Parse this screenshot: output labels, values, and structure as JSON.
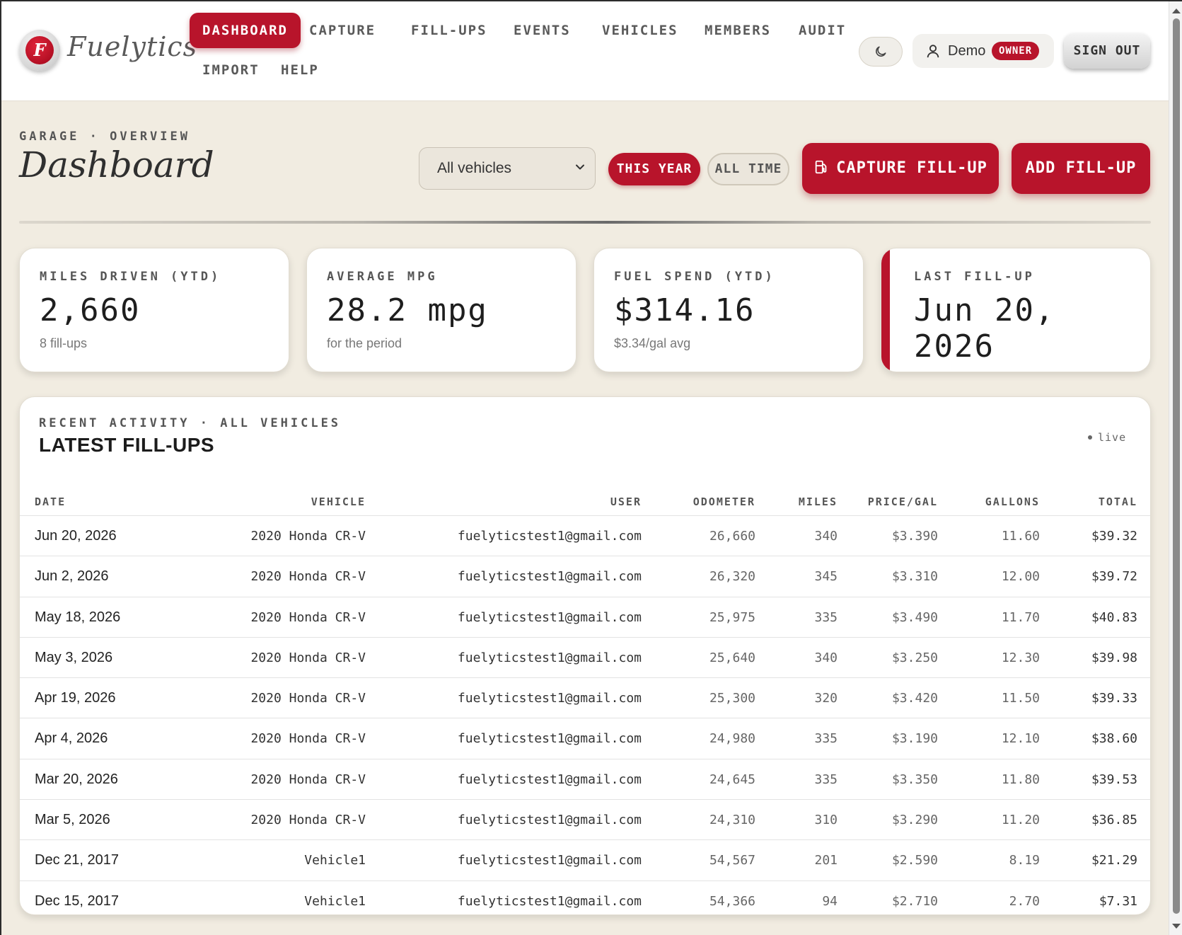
{
  "app": {
    "name": "Fuelytics",
    "logo_letter": "F"
  },
  "nav": {
    "items": [
      {
        "label": "DASHBOARD",
        "active": true
      },
      {
        "label": "CAPTURE",
        "active": false
      },
      {
        "label": "FILL-UPS",
        "active": false
      },
      {
        "label": "EVENTS",
        "active": false
      },
      {
        "label": "VEHICLES",
        "active": false
      },
      {
        "label": "MEMBERS",
        "active": false
      },
      {
        "label": "AUDIT",
        "active": false
      },
      {
        "label": "IMPORT",
        "active": false
      },
      {
        "label": "HELP",
        "active": false
      }
    ]
  },
  "header": {
    "theme_icon": "moon-icon",
    "user_name": "Demo",
    "role_badge": "OWNER",
    "signout_label": "SIGN OUT"
  },
  "page": {
    "eyebrow": "GARAGE · OVERVIEW",
    "title": "Dashboard",
    "vehicle_filter": {
      "selected": "All vehicles"
    },
    "range_buttons": {
      "this_year": "THIS YEAR",
      "all_time": "ALL TIME",
      "selected": "THIS YEAR"
    },
    "capture_label": "CAPTURE FILL-UP",
    "add_label": "ADD FILL-UP"
  },
  "stats": [
    {
      "label": "MILES DRIVEN (YTD)",
      "value": "2,660",
      "sub": "8 fill-ups"
    },
    {
      "label": "AVERAGE MPG",
      "value": "28.2 mpg",
      "sub": "for the period"
    },
    {
      "label": "FUEL SPEND (YTD)",
      "value": "$314.16",
      "sub": "$3.34/gal avg"
    },
    {
      "label": "LAST FILL-UP",
      "value": "Jun 20, 2026",
      "sub": ""
    }
  ],
  "fillups": {
    "eyebrow": "RECENT ACTIVITY · ALL VEHICLES",
    "title": "LATEST FILL-UPS",
    "live_label": "live",
    "columns": [
      "DATE",
      "VEHICLE",
      "USER",
      "ODOMETER",
      "MILES",
      "PRICE/GAL",
      "GALLONS",
      "TOTAL"
    ],
    "rows": [
      {
        "date": "Jun 20, 2026",
        "vehicle": "2020 Honda CR-V",
        "user": "fuelyticstest1@gmail.com",
        "odometer": "26,660",
        "miles": "340",
        "price": "$3.390",
        "gallons": "11.60",
        "total": "$39.32"
      },
      {
        "date": "Jun 2, 2026",
        "vehicle": "2020 Honda CR-V",
        "user": "fuelyticstest1@gmail.com",
        "odometer": "26,320",
        "miles": "345",
        "price": "$3.310",
        "gallons": "12.00",
        "total": "$39.72"
      },
      {
        "date": "May 18, 2026",
        "vehicle": "2020 Honda CR-V",
        "user": "fuelyticstest1@gmail.com",
        "odometer": "25,975",
        "miles": "335",
        "price": "$3.490",
        "gallons": "11.70",
        "total": "$40.83"
      },
      {
        "date": "May 3, 2026",
        "vehicle": "2020 Honda CR-V",
        "user": "fuelyticstest1@gmail.com",
        "odometer": "25,640",
        "miles": "340",
        "price": "$3.250",
        "gallons": "12.30",
        "total": "$39.98"
      },
      {
        "date": "Apr 19, 2026",
        "vehicle": "2020 Honda CR-V",
        "user": "fuelyticstest1@gmail.com",
        "odometer": "25,300",
        "miles": "320",
        "price": "$3.420",
        "gallons": "11.50",
        "total": "$39.33"
      },
      {
        "date": "Apr 4, 2026",
        "vehicle": "2020 Honda CR-V",
        "user": "fuelyticstest1@gmail.com",
        "odometer": "24,980",
        "miles": "335",
        "price": "$3.190",
        "gallons": "12.10",
        "total": "$38.60"
      },
      {
        "date": "Mar 20, 2026",
        "vehicle": "2020 Honda CR-V",
        "user": "fuelyticstest1@gmail.com",
        "odometer": "24,645",
        "miles": "335",
        "price": "$3.350",
        "gallons": "11.80",
        "total": "$39.53"
      },
      {
        "date": "Mar 5, 2026",
        "vehicle": "2020 Honda CR-V",
        "user": "fuelyticstest1@gmail.com",
        "odometer": "24,310",
        "miles": "310",
        "price": "$3.290",
        "gallons": "11.20",
        "total": "$36.85"
      },
      {
        "date": "Dec 21, 2017",
        "vehicle": "Vehicle1",
        "user": "fuelyticstest1@gmail.com",
        "odometer": "54,567",
        "miles": "201",
        "price": "$2.590",
        "gallons": "8.19",
        "total": "$21.29"
      },
      {
        "date": "Dec 15, 2017",
        "vehicle": "Vehicle1",
        "user": "fuelyticstest1@gmail.com",
        "odometer": "54,366",
        "miles": "94",
        "price": "$2.710",
        "gallons": "2.70",
        "total": "$7.31"
      }
    ]
  },
  "colors": {
    "accent": "#b8142b",
    "background": "#f1ece1",
    "card": "#ffffff"
  }
}
